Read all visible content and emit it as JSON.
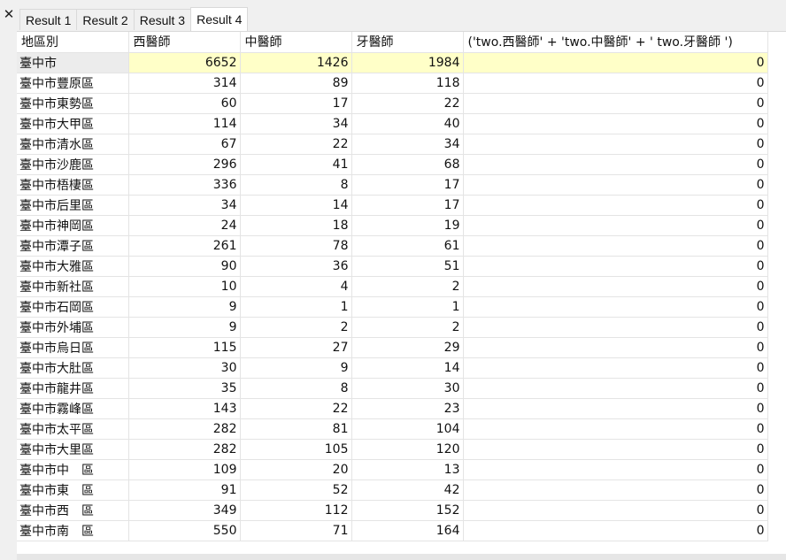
{
  "tabs": [
    "Result 1",
    "Result 2",
    "Result 3",
    "Result 4"
  ],
  "active_tab": 3,
  "close_label": "✕",
  "columns": [
    "地區別",
    "西醫師",
    "中醫師",
    "牙醫師",
    "('two.西醫師' + 'two.中醫師' + ' two.牙醫師 ')"
  ],
  "rows": [
    [
      "臺中市",
      "6652",
      "1426",
      "1984",
      "0"
    ],
    [
      "臺中市豐原區",
      "314",
      "89",
      "118",
      "0"
    ],
    [
      "臺中市東勢區",
      "60",
      "17",
      "22",
      "0"
    ],
    [
      "臺中市大甲區",
      "114",
      "34",
      "40",
      "0"
    ],
    [
      "臺中市清水區",
      "67",
      "22",
      "34",
      "0"
    ],
    [
      "臺中市沙鹿區",
      "296",
      "41",
      "68",
      "0"
    ],
    [
      "臺中市梧棲區",
      "336",
      "8",
      "17",
      "0"
    ],
    [
      "臺中市后里區",
      "34",
      "14",
      "17",
      "0"
    ],
    [
      "臺中市神岡區",
      "24",
      "18",
      "19",
      "0"
    ],
    [
      "臺中市潭子區",
      "261",
      "78",
      "61",
      "0"
    ],
    [
      "臺中市大雅區",
      "90",
      "36",
      "51",
      "0"
    ],
    [
      "臺中市新社區",
      "10",
      "4",
      "2",
      "0"
    ],
    [
      "臺中市石岡區",
      "9",
      "1",
      "1",
      "0"
    ],
    [
      "臺中市外埔區",
      "9",
      "2",
      "2",
      "0"
    ],
    [
      "臺中市烏日區",
      "115",
      "27",
      "29",
      "0"
    ],
    [
      "臺中市大肚區",
      "30",
      "9",
      "14",
      "0"
    ],
    [
      "臺中市龍井區",
      "35",
      "8",
      "30",
      "0"
    ],
    [
      "臺中市霧峰區",
      "143",
      "22",
      "23",
      "0"
    ],
    [
      "臺中市太平區",
      "282",
      "81",
      "104",
      "0"
    ],
    [
      "臺中市大里區",
      "282",
      "105",
      "120",
      "0"
    ],
    [
      "臺中市中　區",
      "109",
      "20",
      "13",
      "0"
    ],
    [
      "臺中市東　區",
      "91",
      "52",
      "42",
      "0"
    ],
    [
      "臺中市西　區",
      "349",
      "112",
      "152",
      "0"
    ],
    [
      "臺中市南　區",
      "550",
      "71",
      "164",
      "0"
    ]
  ]
}
